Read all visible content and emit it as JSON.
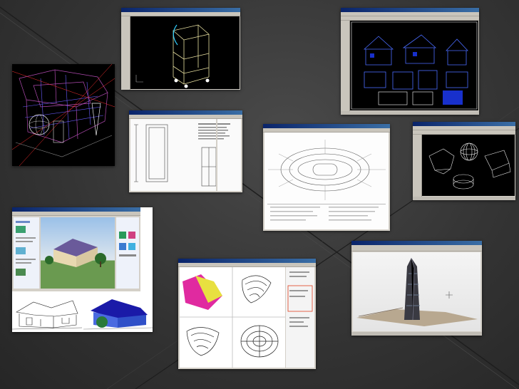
{
  "slide": {
    "background": "#343434",
    "accent_line": "#1c1c1c"
  },
  "thumbnails": [
    {
      "id": "wireframe-building-3d",
      "canvas": "black"
    },
    {
      "id": "cad-3d-frame-model",
      "canvas": "black"
    },
    {
      "id": "house-blueprint-drawings",
      "canvas": "black"
    },
    {
      "id": "door-detail-drawing",
      "canvas": "white"
    },
    {
      "id": "stadium-plan-drawing",
      "canvas": "white"
    },
    {
      "id": "3d-solids-modeling",
      "canvas": "black"
    },
    {
      "id": "house-3d-rendering",
      "canvas": "white"
    },
    {
      "id": "surface-modeling-views",
      "canvas": "white"
    },
    {
      "id": "tower-3d-rendering",
      "canvas": "white"
    }
  ]
}
